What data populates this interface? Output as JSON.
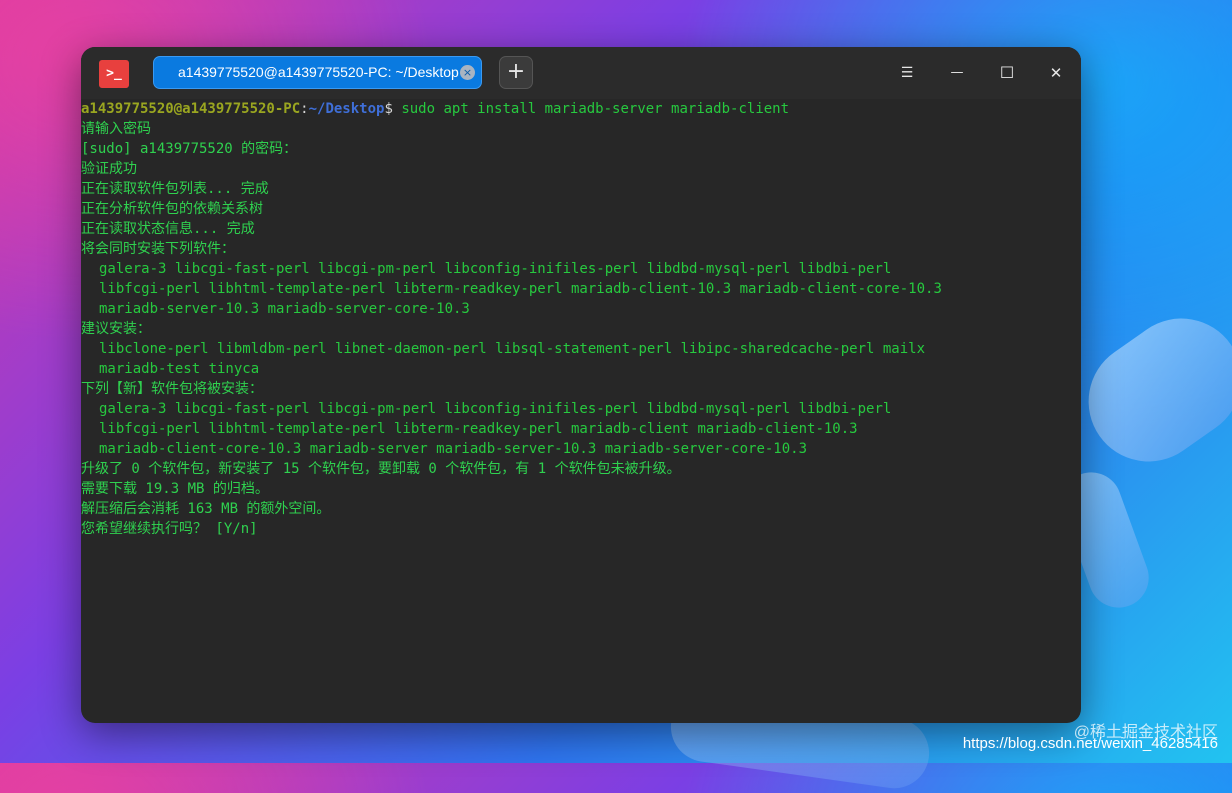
{
  "window": {
    "tab_title": "a1439775520@a1439775520-PC: ~/Desktop",
    "tab_close_glyph": "×",
    "new_tab_glyph": "+",
    "menu_glyph": "☰",
    "minimize_glyph": "—",
    "maximize_glyph": "☐",
    "close_glyph": "✕",
    "app_icon_text": ">_"
  },
  "terminal": {
    "prompt_user": "a1439775520@a1439775520-PC",
    "prompt_colon": ":",
    "prompt_path": "~/Desktop",
    "prompt_dollar": "$",
    "command": " sudo apt install mariadb-server mariadb-client",
    "lines": [
      "请输入密码",
      "[sudo] a1439775520 的密码：",
      "验证成功",
      "正在读取软件包列表... 完成",
      "正在分析软件包的依赖关系树",
      "正在读取状态信息... 完成",
      "将会同时安装下列软件：",
      "galera-3 libcgi-fast-perl libcgi-pm-perl libconfig-inifiles-perl libdbd-mysql-perl libdbi-perl",
      "libfcgi-perl libhtml-template-perl libterm-readkey-perl mariadb-client-10.3 mariadb-client-core-10.3",
      "mariadb-server-10.3 mariadb-server-core-10.3",
      "建议安装：",
      "libclone-perl libmldbm-perl libnet-daemon-perl libsql-statement-perl libipc-sharedcache-perl mailx",
      "mariadb-test tinyca",
      "下列【新】软件包将被安装：",
      "galera-3 libcgi-fast-perl libcgi-pm-perl libconfig-inifiles-perl libdbd-mysql-perl libdbi-perl",
      "libfcgi-perl libhtml-template-perl libterm-readkey-perl mariadb-client mariadb-client-10.3",
      "mariadb-client-core-10.3 mariadb-server mariadb-server-10.3 mariadb-server-core-10.3",
      "升级了 0 个软件包，新安装了 15 个软件包，要卸载 0 个软件包，有 1 个软件包未被升级。",
      "需要下载 19.3 MB 的归档。",
      "解压缩后会消耗 163 MB 的额外空间。",
      "您希望继续执行吗？ [Y/n]"
    ]
  },
  "watermark": {
    "brand": "@稀土掘金技术社区",
    "url": "https://blog.csdn.net/weixin_46285416"
  }
}
